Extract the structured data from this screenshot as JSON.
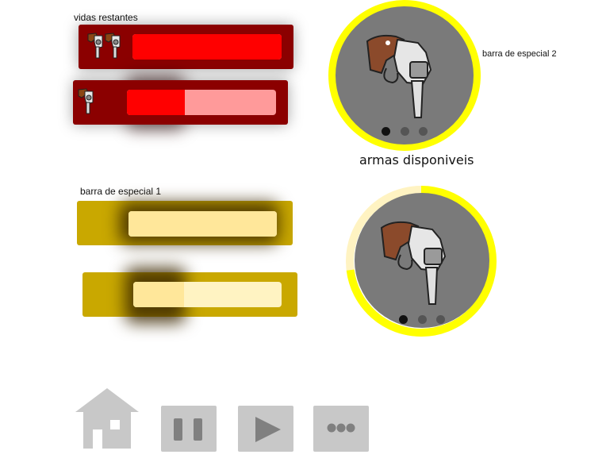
{
  "lives": {
    "label": "vidas restantes",
    "bar1_fill": 1.0,
    "bar2_fill": 0.39,
    "colors": {
      "panel": "#8b0000",
      "fill": "#ff0000",
      "empty": "#ff9a9a"
    }
  },
  "special1": {
    "label": "barra de especial 1",
    "bar1_fill": 1.0,
    "bar2_fill": 0.34,
    "colors": {
      "panel": "#c9a800",
      "fill": "#ffe79a",
      "empty": "#fff3c2"
    }
  },
  "special2": {
    "label": "barra de especial 2",
    "ring_progress": 0.27
  },
  "weapons": {
    "label": "armas disponiveis",
    "pages": 3,
    "active_page": 1,
    "icon": "revolver-icon",
    "accent": "#ffff00"
  },
  "nav": {
    "home_icon": "home-icon",
    "pause_icon": "pause-icon",
    "play_icon": "play-icon",
    "more_icon": "more-icon"
  }
}
